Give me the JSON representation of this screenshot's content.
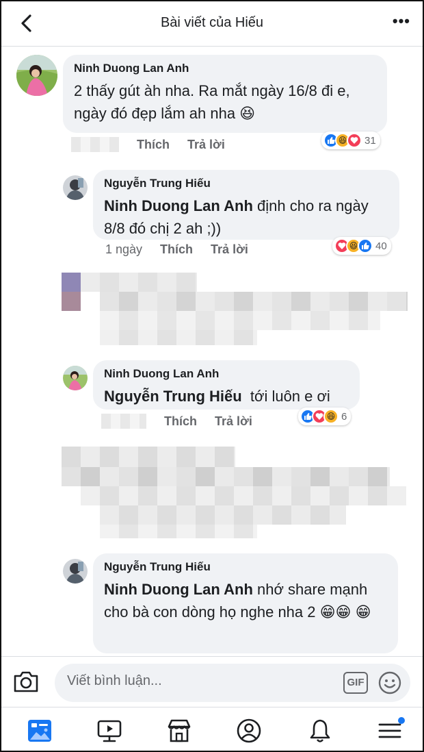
{
  "header": {
    "title": "Bài viết của Hiếu"
  },
  "comments": [
    {
      "author": "Ninh Duong Lan Anh",
      "text": "2 thấy gút àh nha. Ra mắt ngày 16/8 đi e, ngày đó đẹp lắm ah nha 😆",
      "like_label": "Thích",
      "reply_label": "Trả lời",
      "reactions": [
        "like",
        "haha",
        "love"
      ],
      "reaction_count": "31"
    },
    {
      "author": "Nguyễn Trung Hiếu",
      "tag": "Ninh Duong Lan Anh",
      "text": " định cho ra ngày 8/8 đó chị 2 ah ;))",
      "time": "1 ngày",
      "like_label": "Thích",
      "reply_label": "Trả lời",
      "reactions": [
        "love",
        "haha",
        "like"
      ],
      "reaction_count": "40"
    },
    {
      "author": "Ninh Duong Lan Anh",
      "tag": "Nguyễn Trung Hiếu",
      "text": "  tới luôn e ơi",
      "like_label": "Thích",
      "reply_label": "Trả lời",
      "reactions": [
        "like",
        "love",
        "haha"
      ],
      "reaction_count": "6"
    },
    {
      "author": "Nguyễn Trung Hiếu",
      "tag": "Ninh Duong Lan Anh",
      "text": " nhớ share mạnh cho bà con dòng họ nghe nha 2 😁😁 😁"
    }
  ],
  "composer": {
    "placeholder": "Viết bình luận...",
    "gif_label": "GIF"
  },
  "tabbar": {
    "items": [
      "news-feed",
      "watch",
      "marketplace",
      "profile",
      "notifications",
      "menu"
    ],
    "active": "news-feed"
  },
  "colors": {
    "accent": "#1877f2",
    "bubble": "#f0f2f5",
    "muted": "#65676b"
  }
}
